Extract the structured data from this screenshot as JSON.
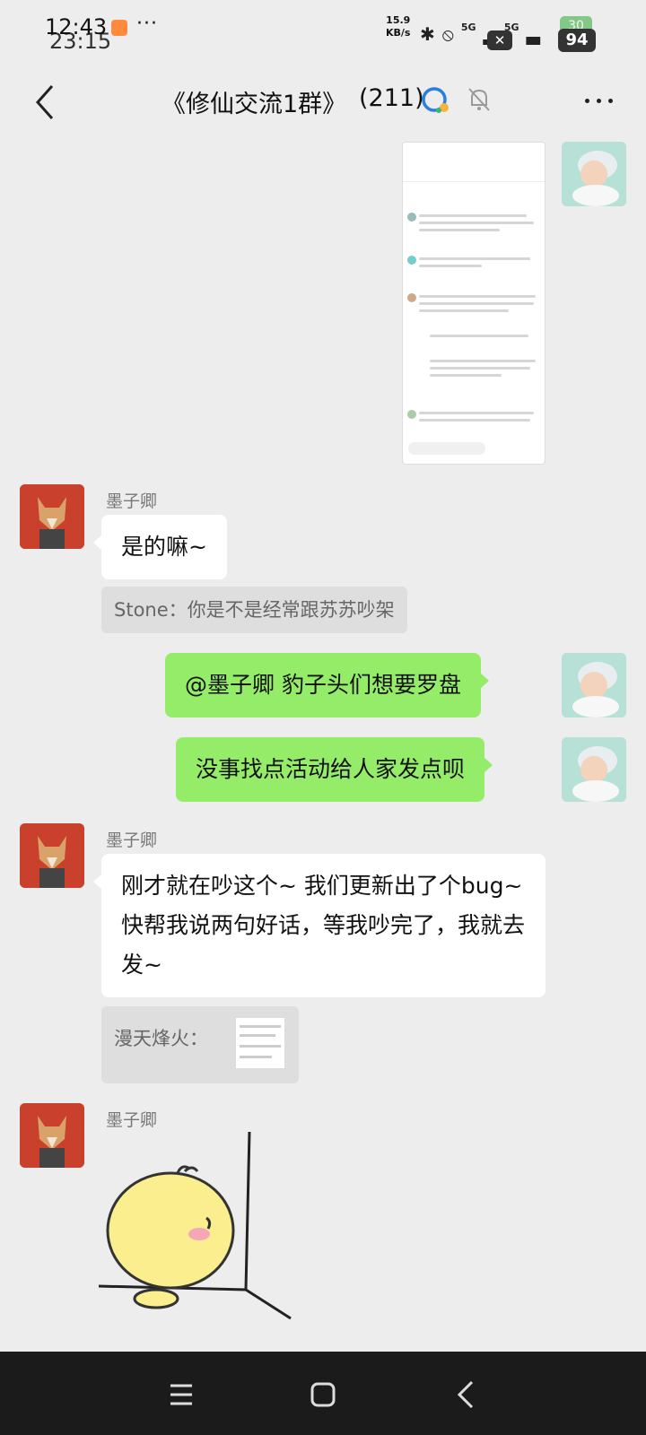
{
  "status_bar": {
    "time_front": "12:43",
    "time_back": "23:15",
    "dots": "···",
    "net_speed_value": "15.9",
    "net_speed_unit": "KB/s",
    "signal_1": "5G",
    "signal_2": "5G",
    "battery_back": "30",
    "battery": "94"
  },
  "header": {
    "title": "《修仙交流1群》",
    "member_count": "(211)"
  },
  "messages": [
    {
      "type": "image",
      "side": "right"
    },
    {
      "type": "text",
      "side": "left",
      "sender": "墨子卿",
      "text": "是的嘛~",
      "quote": "Stone：你是不是经常跟苏苏吵架"
    },
    {
      "type": "text",
      "side": "right",
      "text": "@墨子卿  豹子头们想要罗盘"
    },
    {
      "type": "text",
      "side": "right",
      "text": "没事找点活动给人家发点呗"
    },
    {
      "type": "text",
      "side": "left",
      "sender": "墨子卿",
      "text": "刚才就在吵这个~  我们更新出了个bug~快帮我说两句好话，等我吵完了，我就去发~",
      "quote": "漫天烽火："
    },
    {
      "type": "sticker",
      "side": "left",
      "sender": "墨子卿"
    }
  ],
  "colors": {
    "background": "#ededed",
    "bubble_green": "#95ec69",
    "bubble_white": "#ffffff",
    "navbar": "#1b1b1b"
  }
}
